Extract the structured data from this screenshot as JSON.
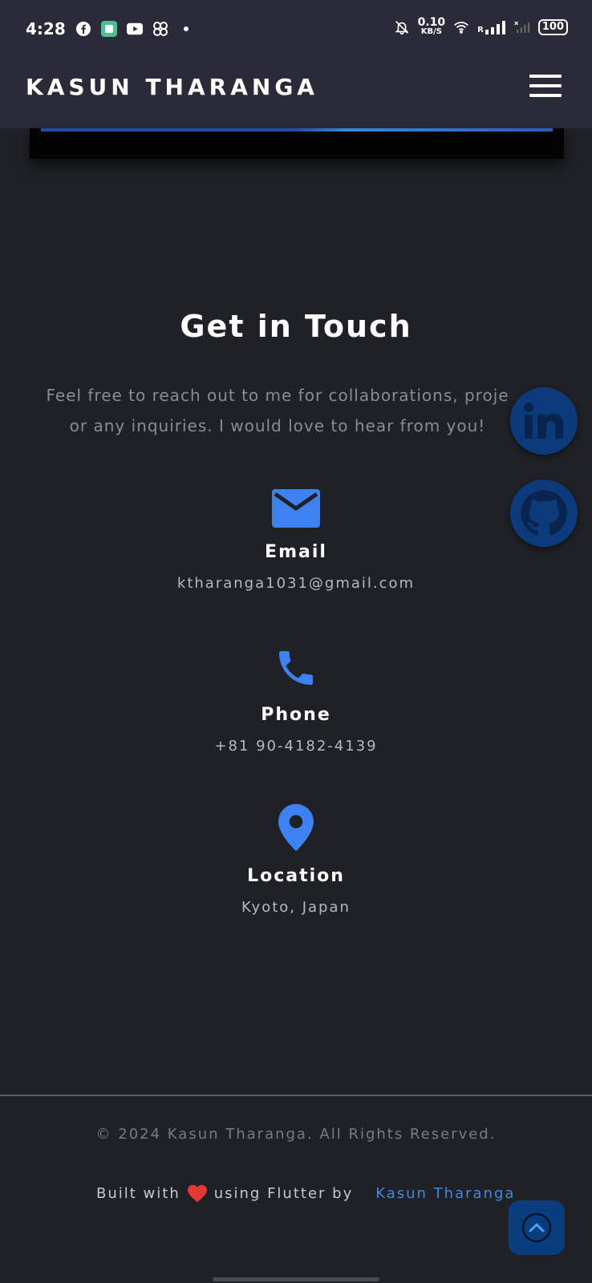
{
  "status_bar": {
    "time": "4:28",
    "speed_value": "0.10",
    "speed_unit": "KB/S",
    "network_r": "R",
    "battery": "100"
  },
  "header": {
    "brand": "KASUN THARANGA"
  },
  "contact": {
    "title": "Get in Touch",
    "description_line1": "Feel free to reach out to me for collaborations, proje",
    "description_line2": "or any inquiries. I would love to hear from you!",
    "items": [
      {
        "label": "Email",
        "value": "ktharanga1031@gmail.com",
        "icon": "mail-icon"
      },
      {
        "label": "Phone",
        "value": "+81 90-4182-4139",
        "icon": "phone-icon"
      },
      {
        "label": "Location",
        "value": "Kyoto, Japan",
        "icon": "location-pin-icon"
      }
    ]
  },
  "footer": {
    "copyright": "© 2024 Kasun Tharanga. All Rights Reserved.",
    "built_prefix": "Built with",
    "built_middle": "using Flutter by",
    "author_link": "Kasun Tharanga"
  },
  "colors": {
    "background": "#1f2126",
    "appbar": "#2a2a38",
    "accent": "#3d82f0",
    "social_bg": "#0d3a7a",
    "heart": "#e53935"
  }
}
